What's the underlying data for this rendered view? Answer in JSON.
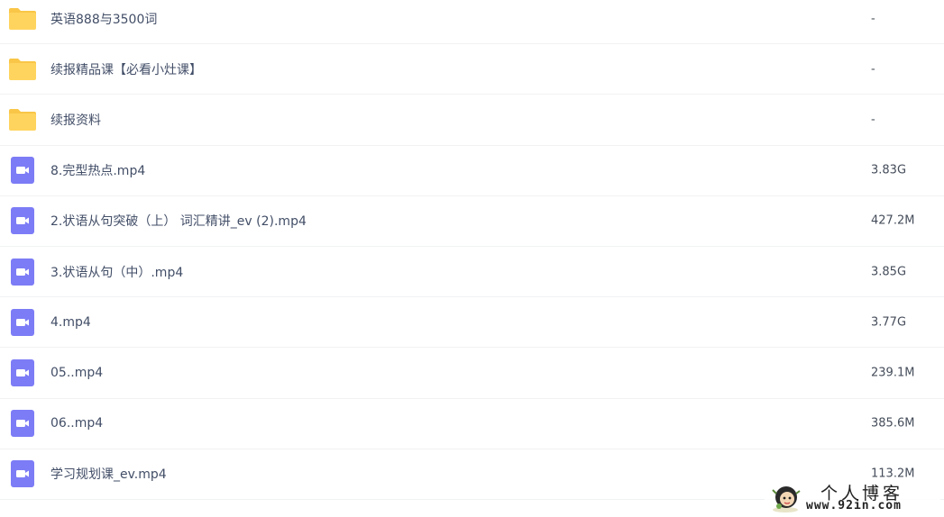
{
  "files": [
    {
      "type": "folder",
      "icon": "folder-icon",
      "name": "英语888与3500词",
      "size": "-"
    },
    {
      "type": "folder",
      "icon": "folder-icon",
      "name": "续报精品课【必看小灶课】",
      "size": "-"
    },
    {
      "type": "folder",
      "icon": "folder-icon",
      "name": "续报资料",
      "size": "-"
    },
    {
      "type": "video",
      "icon": "video-file-icon",
      "name": "8.完型热点.mp4",
      "size": "3.83G"
    },
    {
      "type": "video",
      "icon": "video-file-icon",
      "name": "2.状语从句突破（上） 词汇精讲_ev (2).mp4",
      "size": "427.2M"
    },
    {
      "type": "video",
      "icon": "video-file-icon",
      "name": "3.状语从句（中）.mp4",
      "size": "3.85G"
    },
    {
      "type": "video",
      "icon": "video-file-icon",
      "name": "4.mp4",
      "size": "3.77G"
    },
    {
      "type": "video",
      "icon": "video-file-icon",
      "name": "05..mp4",
      "size": "239.1M"
    },
    {
      "type": "video",
      "icon": "video-file-icon",
      "name": "06..mp4",
      "size": "385.6M"
    },
    {
      "type": "video",
      "icon": "video-file-icon",
      "name": "学习规划课_ev.mp4",
      "size": "113.2M"
    }
  ],
  "watermark": {
    "title": "个人博客",
    "url": "www.92in.com",
    "icon": "cartoon-avatar-icon"
  },
  "colors": {
    "folder": "#ffd45e",
    "folder_tab": "#f9c647",
    "video": "#7c7cf6",
    "text": "#424e67",
    "divider": "#f1f2f4"
  }
}
